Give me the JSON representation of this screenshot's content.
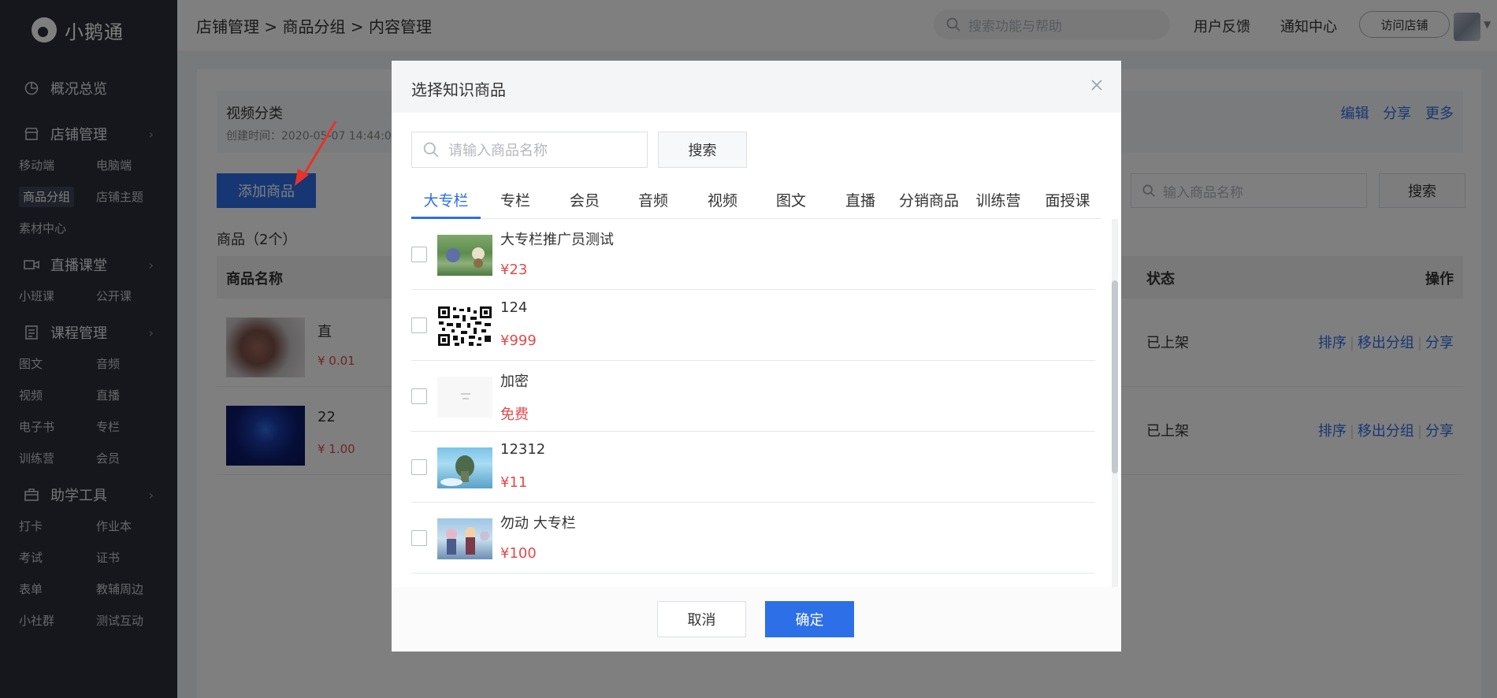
{
  "app": {
    "brand": "小鹅通"
  },
  "sidebar": {
    "groups": [
      {
        "title": "概况总览",
        "icon": "pie-chart-icon",
        "items": []
      },
      {
        "title": "店铺管理",
        "icon": "store-icon",
        "items": [
          "移动端",
          "电脑端",
          "商品分组",
          "店铺主题",
          "素材中心"
        ],
        "active": "商品分组"
      },
      {
        "title": "直播课堂",
        "icon": "video-camera-icon",
        "items": [
          "小班课",
          "公开课"
        ]
      },
      {
        "title": "课程管理",
        "icon": "book-icon",
        "items": [
          "图文",
          "音频",
          "视频",
          "直播",
          "电子书",
          "专栏",
          "训练营",
          "会员"
        ]
      },
      {
        "title": "助学工具",
        "icon": "toolbox-icon",
        "items": [
          "打卡",
          "作业本",
          "考试",
          "证书",
          "表单",
          "教辅周边",
          "小社群",
          "测试互动"
        ]
      }
    ]
  },
  "topbar": {
    "breadcrumb": "店铺管理 > 商品分组 > 内容管理",
    "search_placeholder": "搜索功能与帮助",
    "feedback": "用户反馈",
    "notifications": "通知中心",
    "visit_store": "访问店铺"
  },
  "page": {
    "group_title": "视频分类",
    "created_time": "创建时间：2020-05-07 14:44:0",
    "actions": [
      "编辑",
      "分享",
      "更多"
    ],
    "add_button": "添加商品",
    "search_placeholder": "输入商品名称",
    "search_button": "搜索",
    "count_label": "商品（2个）",
    "columns": {
      "name": "商品名称",
      "status": "状态",
      "ops": "操作"
    },
    "rows": [
      {
        "name": "直",
        "price": "¥ 0.01",
        "status": "已上架",
        "ops": [
          "排序",
          "移出分组",
          "分享"
        ]
      },
      {
        "name": "22",
        "price": "¥ 1.00",
        "status": "已上架",
        "ops": [
          "排序",
          "移出分组",
          "分享"
        ]
      }
    ]
  },
  "modal": {
    "title": "选择知识商品",
    "search_placeholder": "请输入商品名称",
    "search_button": "搜索",
    "tabs": [
      "大专栏",
      "专栏",
      "会员",
      "音频",
      "视频",
      "图文",
      "直播",
      "分销商品",
      "训练营",
      "面授课"
    ],
    "active_tab": "大专栏",
    "items": [
      {
        "name": "大专栏推广员测试",
        "price": "¥23"
      },
      {
        "name": "124",
        "price": "¥999"
      },
      {
        "name": "加密",
        "price": "免费"
      },
      {
        "name": "12312",
        "price": "¥11"
      },
      {
        "name": "勿动 大专栏",
        "price": "¥100"
      }
    ],
    "cancel": "取消",
    "confirm": "确定"
  },
  "colors": {
    "accent": "#2d6fe6",
    "price": "#e04b4b",
    "sidebar_bg": "#2a2e3a"
  }
}
